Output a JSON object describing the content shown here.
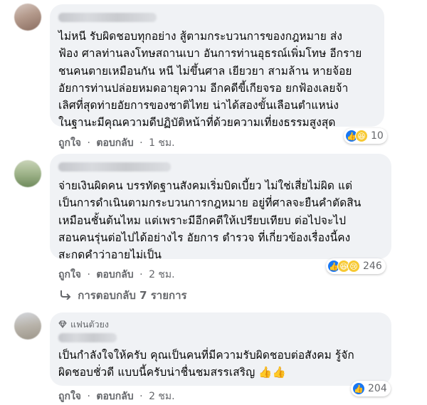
{
  "comments": [
    {
      "text_lines": [
        "ไม่หนี รับผิดชอบทุกอย่าง สู้ตามกระบวนการของกฎหมาย ส่ง",
        "ฟ้อง ศาลท่านลงโทษสถานเบา อันการท่านอุธรณ์เพิ่มโทษ อีกราย",
        "ชนคนตายเหมือนกัน หนี ไม่ขึ้นศาล เยียวยา สามล้าน หายจ้อย",
        "อัยการท่านปล่อยหมดอายุความ อีกคดีขี้เกียจรอ ยกฟ้องเลยจ้า",
        "เลิศที่สุดท่ายอัยการของชาติไทย น่าได้สองขั้นเลือนตำแหน่ง",
        "ในฐานะมีคุณความดีปฏิบัติหน้าที่ด้วยความเที่ยงธรรมสูงสุด"
      ],
      "like_label": "ถูกใจ",
      "reply_label": "ตอบกลับ",
      "time": "1 ชม.",
      "reaction_count": "10"
    },
    {
      "text_lines": [
        "จ่ายเงินผิดคน บรรทัดฐานสังคมเริ่มบิดเบี้ยว ไม่ใช่เสี่ยไม่ผิด แต่",
        "เป็นการดำเนินตามกระบวนการกฎหมาย อยู่ที่ศาลจะยืนคำตัดสิน",
        "เหมือนชั้นต้นไหม แต่เพราะมีอีกคดีให้เปรียบเทียบ ต่อไปจะไป",
        "สอนคนรุ่นต่อไปได้อย่างไร อัยการ ตำรวจ ที่เกี่ยวข้องเรื่องนี้คง",
        "สะกดคำว่าอายไม่เป็น"
      ],
      "like_label": "ถูกใจ",
      "reply_label": "ตอบกลับ",
      "time": "2 ชม.",
      "reaction_count": "246",
      "replies_label": "การตอบกลับ 7 รายการ"
    },
    {
      "badge": "แฟนตัวยง",
      "text_lines": [
        "เป็นกำลังใจให้ครับ คุณเป็นคนที่มีความรับผิดชอบต่อสังคม รู้จัก",
        "ผิดชอบชั่วดี แบบนี้ครับน่าชื่นชมสรรเสริญ 👍👍"
      ],
      "like_label": "ถูกใจ",
      "reply_label": "ตอบกลับ",
      "time": "2 ชม.",
      "reaction_count": "204"
    }
  ],
  "icons": {
    "like": "like-icon",
    "haha": "haha-icon",
    "sad": "sad-icon",
    "reply_arrow": "reply-arrow-icon",
    "badge": "diamond-icon"
  }
}
